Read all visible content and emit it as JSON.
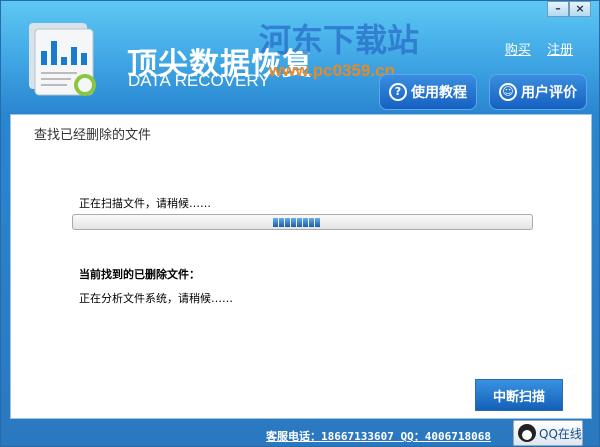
{
  "app": {
    "title": "顶尖数据恢复",
    "subtitle": "DATA RECOVERY"
  },
  "watermark": {
    "line1": "河东下载站",
    "line2": "www.pc0359.cn"
  },
  "window_controls": {
    "minimize": "–",
    "close": "×"
  },
  "header_links": {
    "buy": "购买",
    "register": "注册"
  },
  "header_buttons": {
    "tutorial": "使用教程",
    "reviews": "用户评价"
  },
  "panel": {
    "title": "查找已经删除的文件",
    "scan_status": "正在扫描文件，请稍候……",
    "found_label": "当前找到的已删除文件：",
    "analyze_status": "正在分析文件系统，请稍候……",
    "stop_button": "中断扫描"
  },
  "progress": {
    "mode": "indeterminate"
  },
  "footer": {
    "contact": "客服电话：18667133607 QQ：4006718068",
    "qq_button": "QQ在线"
  }
}
